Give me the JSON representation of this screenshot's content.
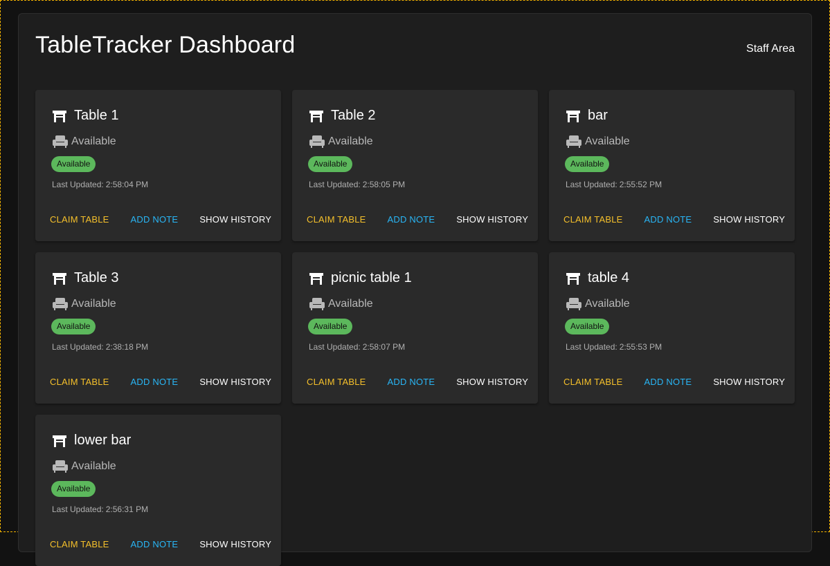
{
  "header": {
    "title": "TableTracker Dashboard",
    "staff_label": "Staff Area"
  },
  "colors": {
    "badge_available": "#5cb85c",
    "claim": "#f5c02b",
    "note": "#29b6f6",
    "frame_outline": "#f5b400"
  },
  "labels": {
    "last_updated": "Last Updated:",
    "claim": "CLAIM TABLE",
    "note": "ADD NOTE",
    "history": "SHOW HISTORY"
  },
  "tables": [
    {
      "name": "Table 1",
      "status": "Available",
      "badge": "Available",
      "updated": "2:58:04 PM"
    },
    {
      "name": "Table 2",
      "status": "Available",
      "badge": "Available",
      "updated": "2:58:05 PM"
    },
    {
      "name": "bar",
      "status": "Available",
      "badge": "Available",
      "updated": "2:55:52 PM"
    },
    {
      "name": "Table 3",
      "status": "Available",
      "badge": "Available",
      "updated": "2:38:18 PM"
    },
    {
      "name": "picnic table 1",
      "status": "Available",
      "badge": "Available",
      "updated": "2:58:07 PM"
    },
    {
      "name": "table 4",
      "status": "Available",
      "badge": "Available",
      "updated": "2:55:53 PM"
    },
    {
      "name": "lower bar",
      "status": "Available",
      "badge": "Available",
      "updated": "2:56:31 PM"
    }
  ],
  "icons": {
    "table": "table-restaurant-icon",
    "status": "armchair-icon"
  }
}
